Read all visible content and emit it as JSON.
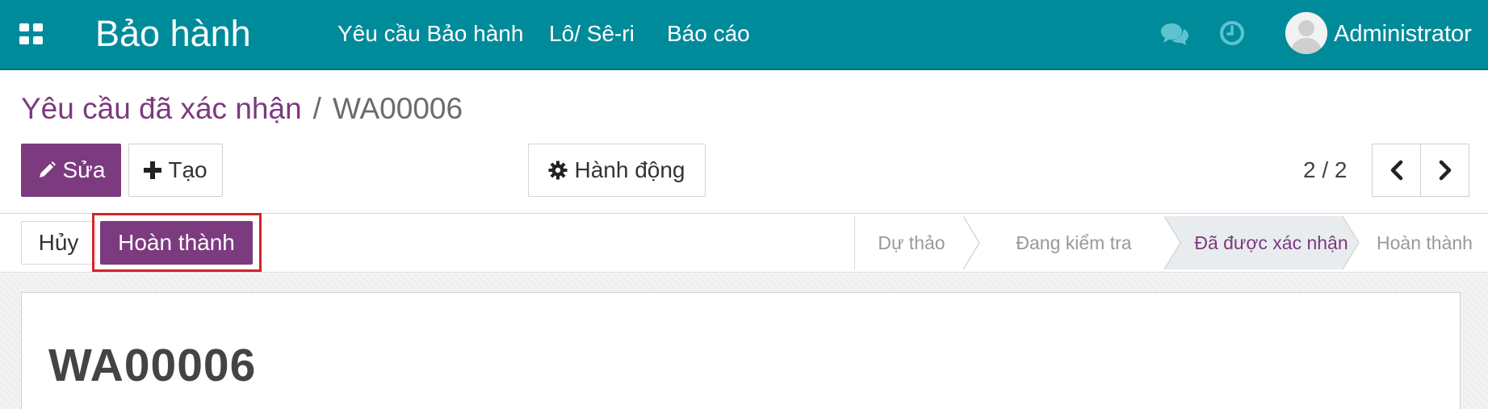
{
  "navbar": {
    "brand": "Bảo hành",
    "menu": [
      "Yêu cầu Bảo hành",
      "Lô/ Sê-ri",
      "Báo cáo"
    ],
    "user_name": "Administrator",
    "bg_color": "#008b9b"
  },
  "breadcrumb": {
    "parent": "Yêu cầu đã xác nhận",
    "separator": "/",
    "current": "WA00006"
  },
  "toolbar": {
    "edit_label": "Sửa",
    "create_label": "Tạo",
    "action_label": "Hành động"
  },
  "pager": {
    "value": "2 / 2"
  },
  "statusbar": {
    "cancel_label": "Hủy",
    "done_label": "Hoàn thành",
    "stages": [
      "Dự thảo",
      "Đang kiểm tra",
      "Đã được xác nhận",
      "Hoàn thành"
    ],
    "active_stage": "Đã được xác nhận"
  },
  "form": {
    "record_name": "WA00006"
  },
  "colors": {
    "primary": "#7c3a7f",
    "highlight": "#d0252b"
  }
}
